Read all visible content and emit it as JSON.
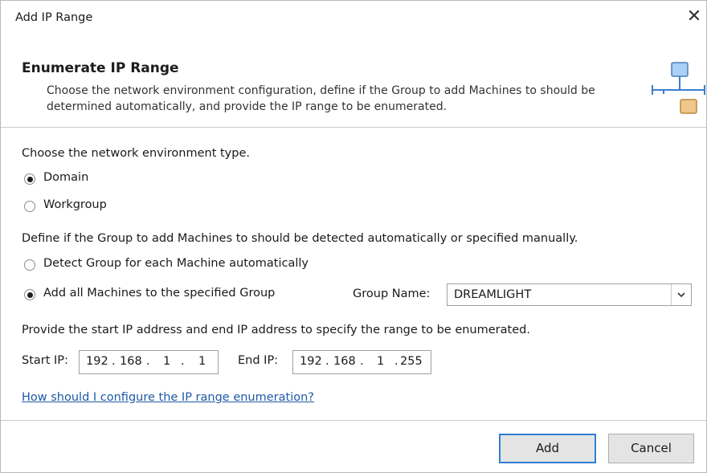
{
  "window": {
    "title": "Add IP Range",
    "close_glyph": "✕"
  },
  "header": {
    "title": "Enumerate IP Range",
    "description": "Choose the network environment configuration, define if the Group to add Machines to should be determined automatically, and provide the IP range to be enumerated.",
    "icon": "network-icon"
  },
  "network": {
    "prompt": "Choose the network environment type.",
    "options": [
      {
        "label": "Domain",
        "checked": true
      },
      {
        "label": "Workgroup",
        "checked": false
      }
    ]
  },
  "group": {
    "prompt": "Define if the Group to add Machines to should be detected automatically or specified manually.",
    "options": [
      {
        "label": "Detect Group for each Machine automatically",
        "checked": false
      },
      {
        "label": "Add all Machines to the specified Group",
        "checked": true
      }
    ],
    "name_label": "Group Name:",
    "name_value": "DREAMLIGHT"
  },
  "ip": {
    "prompt": "Provide the start IP address and end IP address to specify the range to be enumerated.",
    "start_label": "Start IP:",
    "start": [
      "192",
      "168",
      "1",
      "1"
    ],
    "end_label": "End IP:",
    "end": [
      "192",
      "168",
      "1",
      "255"
    ]
  },
  "help_link": "How should I configure the IP range enumeration?",
  "buttons": {
    "add": "Add",
    "cancel": "Cancel"
  },
  "colors": {
    "accent": "#2f7fd2",
    "link": "#1e5aa8",
    "monitor_blue": "#a9d0f5",
    "monitor_orange": "#f1c68a"
  }
}
